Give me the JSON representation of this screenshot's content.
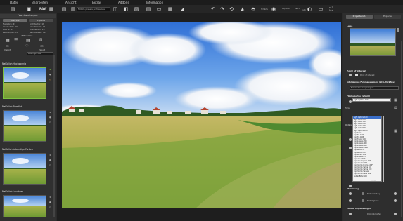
{
  "menu": [
    "Datei",
    "Bearbeiten",
    "Ansicht",
    "Extras",
    "Addons",
    "Information"
  ],
  "toolbar": {
    "tool_labels": [
      "Öffnen",
      "Speichern",
      "Preset",
      "Vorschau"
    ],
    "preset_select": "FOCUS presets professional",
    "bracket_label": "Schärfe",
    "value_label": "Exposure",
    "value": "100",
    "percent": "%",
    "right_label": "Auto"
  },
  "left_panel": {
    "header": "Voreinstellungen",
    "filters_left": [
      "Alle: 192",
      "Natürlich: 23",
      "Landschaft: 29",
      "Porträt: 15",
      "Zeitlos-gen: 33"
    ],
    "filters_right": [
      "Experte",
      "Architektur: 18",
      "Künstlerisch: 31",
      "Dramatisch: 23",
      "Jahreszeiten: 19"
    ],
    "favorites": "Favoriten",
    "import_label": "Import",
    "export_label": "Export",
    "select_label": "Lieblings Filter",
    "templates": [
      {
        "title": "Natürlich Hochsonnig"
      },
      {
        "title": "Natürlich Bewölkt"
      },
      {
        "title": "Natürlich Lebendige Farben"
      },
      {
        "title": "Natürlich Leuchten"
      }
    ]
  },
  "right_panel": {
    "tabs": [
      "Projekteinst.",
      "Experte"
    ],
    "sections": {
      "lupe": "Lupe",
      "point_of_interest": "Point of Interest",
      "poi_option": "Point of interest",
      "smart_colors": "Intelligentes Farbmanagement (SCA-Workflow)",
      "smart_colors_select": "Farbmodus (ausgewogen)",
      "film_emulation": "Filmbasiertes Farbbild",
      "optimization": "Optimierung",
      "color_label": "Farbe",
      "luts_label": "Profile",
      "apply_label": "Farbe",
      "ambiance": "Stimmung",
      "vignette": "Farbschärfung",
      "warmth": "Farbabgleich",
      "detail": "Lokale Anpassungen",
      "detail_opt": "Detail-Schärfen"
    },
    "lut_list": [
      "Agfa Optima 100",
      "Agfa Ultra 100",
      "Agfa Vista 100",
      "Agfa Vista 200",
      "Agfa Vista 400",
      "Agfa Vista 800",
      "Agfa Optima 200",
      "Fuji Astia",
      "Fuji Pro 160C",
      "Fuji Pro 400H",
      "Fuji Provia 100F",
      "Fuji Superia 200",
      "Fuji Superia 400",
      "Fuji Superia 800",
      "Fuji Superia 1600",
      "Fuji Velvia 50",
      "Fuji Velvia 100",
      "Fuji Sensia 100",
      "Fuji Superia 1.X",
      "Fujicolor C200",
      "Fujicolor Superia 100",
      "Fujicolor Pro 160",
      "Fujichrome Provia 100F",
      "Fujichrome Velvia 50",
      "Fujichrome Velvia 100",
      "Fujichrome Sensia",
      "Fujichrome Astia 100F",
      "Kodak Ektar 100"
    ]
  },
  "colors": {
    "accent_green": "#7fc241",
    "selection_blue": "#3a6ec9",
    "panel_bg": "#303030",
    "toolbar_bg": "#262626"
  }
}
